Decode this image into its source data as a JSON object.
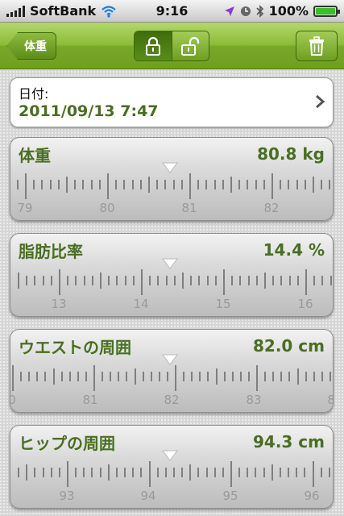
{
  "status_bar": {
    "carrier": "SoftBank",
    "time": "9:16",
    "battery_percent": "100%",
    "battery_level": 1.0,
    "icons": [
      "signal-icon",
      "wifi-icon",
      "location-icon",
      "alarm-icon",
      "bluetooth-icon",
      "battery-icon"
    ]
  },
  "nav": {
    "back_label": "体重",
    "lock_segment": {
      "selected": "lock"
    },
    "icons": [
      "lock-icon",
      "unlock-icon",
      "trash-icon"
    ]
  },
  "date": {
    "label": "日付:",
    "value": "2011/09/13 7:47"
  },
  "measurements": [
    {
      "name": "体重",
      "value": "80.8 kg",
      "ruler_labels": [
        "79",
        "80",
        "81",
        "82"
      ]
    },
    {
      "name": "脂肪比率",
      "value": "14.4 %",
      "ruler_labels": [
        "13",
        "14",
        "15",
        "16"
      ]
    },
    {
      "name": "ウエストの周囲",
      "value": "82.0 cm",
      "ruler_labels": [
        "0",
        "81",
        "82",
        "83",
        "8"
      ]
    },
    {
      "name": "ヒップの周囲",
      "value": "94.3 cm",
      "ruler_labels": [
        "93",
        "94",
        "95",
        "96"
      ]
    }
  ],
  "colors": {
    "accent_green": "#4a6e22",
    "nav_green": "#8cbc38",
    "battery_green": "#3bbf2a"
  }
}
